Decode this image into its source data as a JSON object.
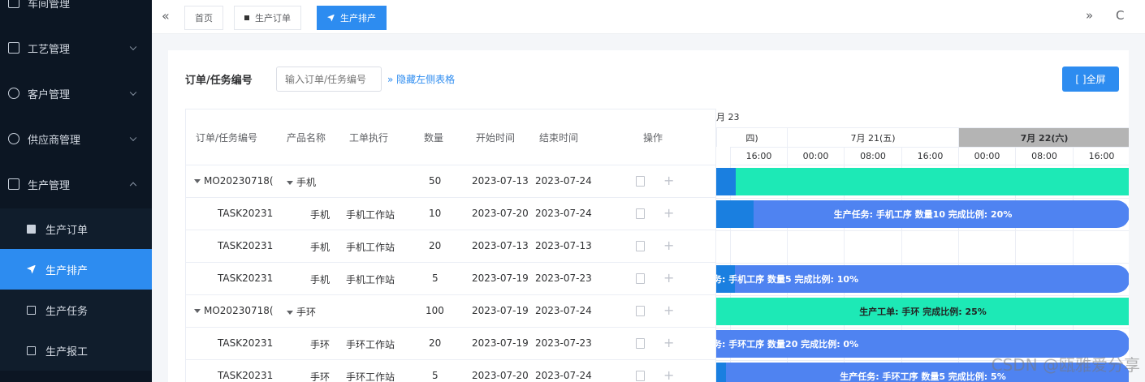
{
  "sidebar": {
    "items": [
      {
        "label": "车间管理",
        "expanded": false
      },
      {
        "label": "工艺管理",
        "expanded": false
      },
      {
        "label": "客户管理",
        "expanded": false
      },
      {
        "label": "供应商管理",
        "expanded": false
      },
      {
        "label": "生产管理",
        "expanded": true
      }
    ],
    "sub_items": [
      {
        "label": "生产订单",
        "active": false
      },
      {
        "label": "生产排产",
        "active": true
      },
      {
        "label": "生产任务",
        "active": false
      },
      {
        "label": "生产报工",
        "active": false
      }
    ]
  },
  "tabs": {
    "collapse_glyph": "«",
    "items": [
      {
        "label": "首页",
        "active": false
      },
      {
        "label": "生产订单",
        "active": false
      },
      {
        "label": "生产排产",
        "active": true
      }
    ],
    "right_glyph": "»",
    "refresh_glyph": "C"
  },
  "filter": {
    "label": "订单/任务编号",
    "placeholder": "输入订单/任务编号",
    "toggle_link": "» 隐藏左侧表格",
    "fullscreen_label": "[ ]全屏"
  },
  "table": {
    "columns": [
      "订单/任务编号",
      "产品名称",
      "工单执行",
      "数量",
      "开始时间",
      "结束时间",
      "操作"
    ],
    "rows": [
      {
        "id": "MO20230718(",
        "product": "手机",
        "station": "",
        "qty": "50",
        "start": "2023-07-13",
        "end": "2023-07-24",
        "parent": true
      },
      {
        "id": "TASK20231",
        "product": "手机",
        "station": "手机工作站",
        "qty": "10",
        "start": "2023-07-20",
        "end": "2023-07-24",
        "parent": false
      },
      {
        "id": "TASK20231",
        "product": "手机",
        "station": "手机工作站",
        "qty": "20",
        "start": "2023-07-13",
        "end": "2023-07-13",
        "parent": false
      },
      {
        "id": "TASK20231",
        "product": "手机",
        "station": "手机工作站",
        "qty": "5",
        "start": "2023-07-19",
        "end": "2023-07-23",
        "parent": false
      },
      {
        "id": "MO20230718(",
        "product": "手环",
        "station": "",
        "qty": "100",
        "start": "2023-07-19",
        "end": "2023-07-24",
        "parent": true
      },
      {
        "id": "TASK20231",
        "product": "手环",
        "station": "手环工作站",
        "qty": "20",
        "start": "2023-07-19",
        "end": "2023-07-23",
        "parent": false
      },
      {
        "id": "TASK20231",
        "product": "手环",
        "station": "手环工作站",
        "qty": "5",
        "start": "2023-07-20",
        "end": "2023-07-24",
        "parent": false
      }
    ]
  },
  "gantt": {
    "month_label": "月 23",
    "days": [
      {
        "label": "四)",
        "weekend": false
      },
      {
        "label": "7月 21(五)",
        "weekend": false
      },
      {
        "label": "7月 22(六)",
        "weekend": true
      }
    ],
    "hours": [
      "16:00",
      "00:00",
      "08:00",
      "16:00",
      "00:00",
      "08:00",
      "16:00"
    ],
    "bars": [
      {
        "text": "",
        "color": "green",
        "progress": 0.05
      },
      {
        "text": "生产任务: 手机工序 数量10 完成比例: 20%",
        "color": "blue",
        "progress": 0.2
      },
      {
        "text": "",
        "color": "none",
        "progress": 0
      },
      {
        "text": "务: 手机工序 数量5 完成比例: 10%",
        "color": "blue",
        "progress": 0.1
      },
      {
        "text": "生产工单: 手环 完成比例: 25%",
        "color": "green",
        "progress": 0.25
      },
      {
        "text": "务: 手环工序 数量20 完成比例: 0%",
        "color": "blue",
        "progress": 0
      },
      {
        "text": "生产任务: 手环工序 数量5 完成比例: 5%",
        "color": "blue",
        "progress": 0.05
      }
    ]
  },
  "watermark": "CSDN @瓯雅爱分享"
}
